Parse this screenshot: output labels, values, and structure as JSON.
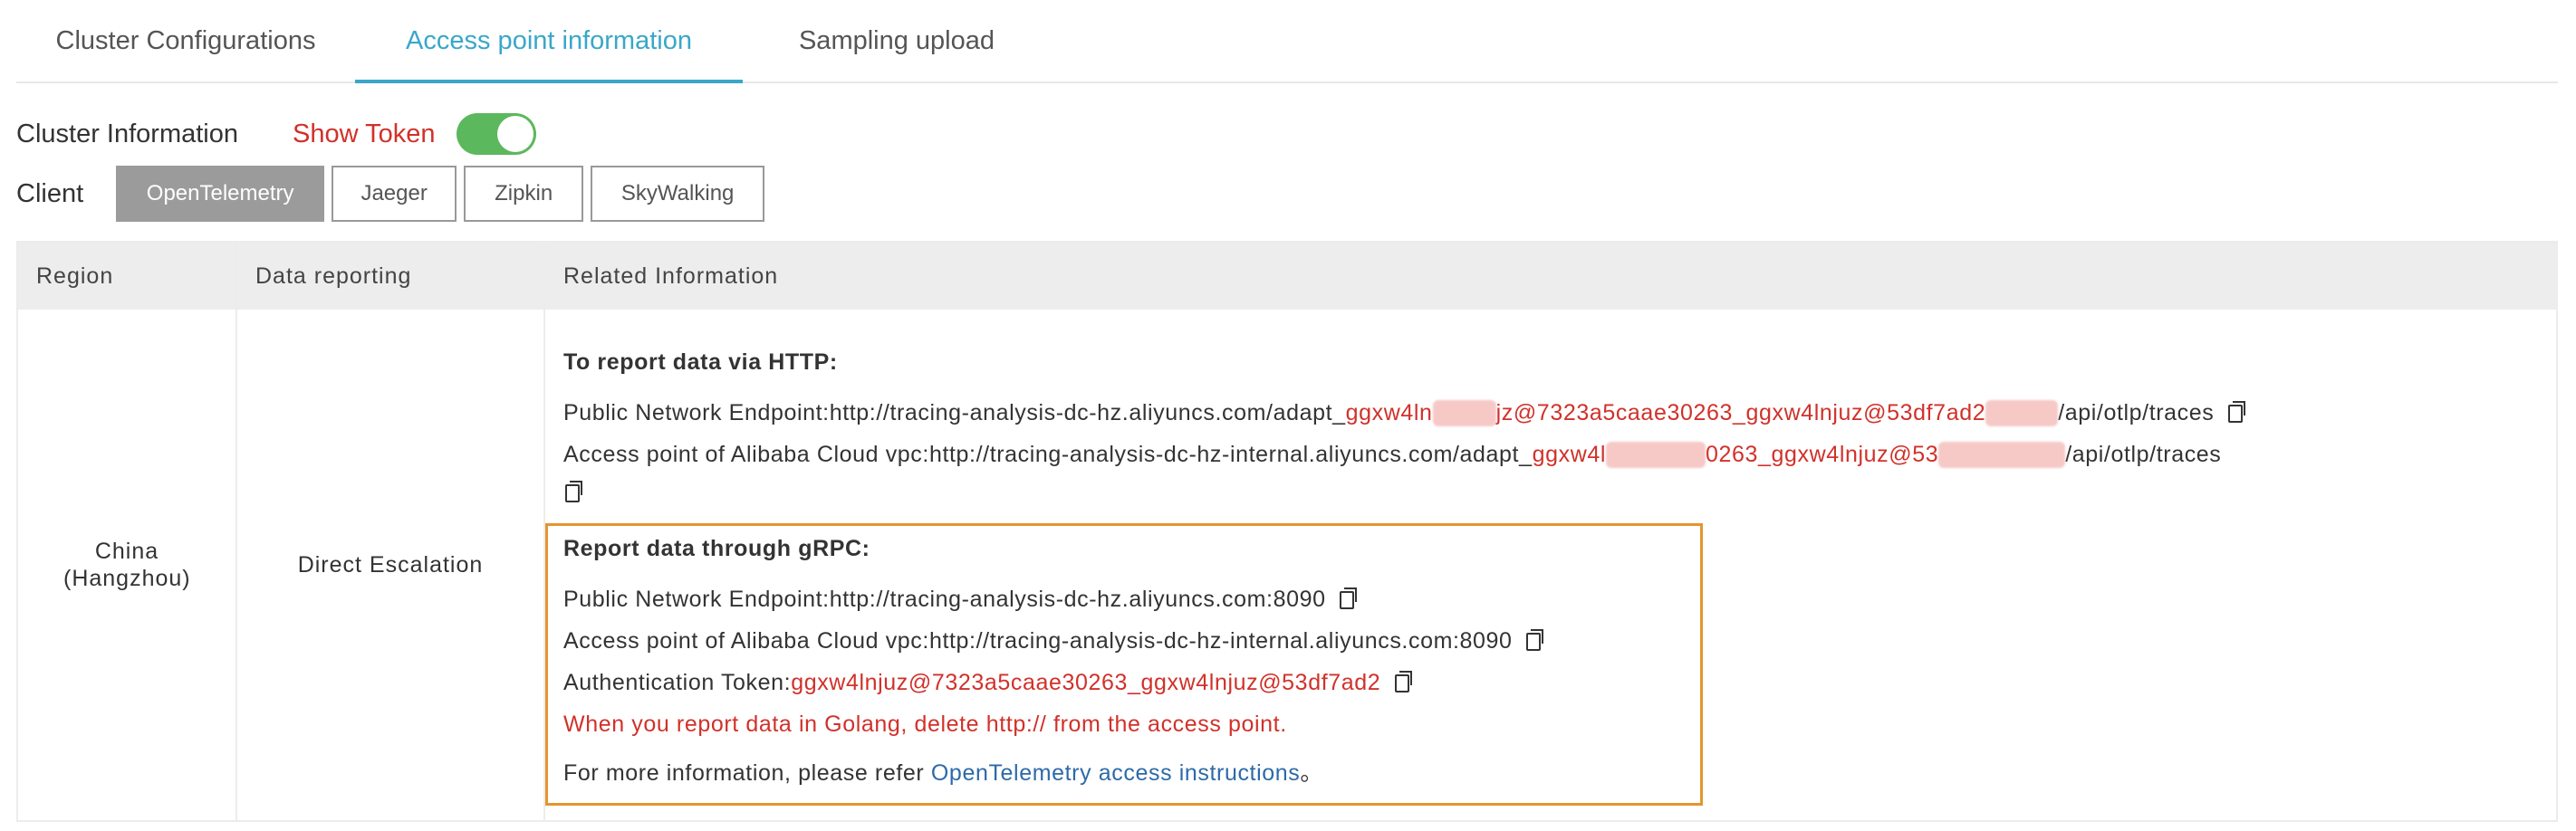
{
  "tabs": {
    "cluster": "Cluster Configurations",
    "access": "Access point information",
    "sampling": "Sampling upload"
  },
  "cluster": {
    "label": "Cluster Information",
    "show_token": "Show Token",
    "toggle_on": true
  },
  "client": {
    "label": "Client",
    "options": [
      "OpenTelemetry",
      "Jaeger",
      "Zipkin",
      "SkyWalking"
    ],
    "selected": "OpenTelemetry"
  },
  "table": {
    "headers": [
      "Region",
      "Data reporting",
      "Related Information"
    ],
    "region": "China (Hangzhou)",
    "data_reporting": "Direct Escalation",
    "http": {
      "title": "To report data via HTTP:",
      "public_prefix": "Public Network Endpoint:http://tracing-analysis-dc-hz.aliyuncs.com/adapt_",
      "public_token_a": "ggxw4ln",
      "public_token_mid": "jz@7323a5caae30263_ggxw4lnjuz@53df7ad2",
      "public_suffix": "/api/otlp/traces",
      "vpc_prefix": "Access point of Alibaba Cloud vpc:http://tracing-analysis-dc-hz-internal.aliyuncs.com/adapt_",
      "vpc_token_a": "ggxw4l",
      "vpc_token_mid": "0263_ggxw4lnjuz@53",
      "vpc_suffix": "/api/otlp/traces"
    },
    "grpc": {
      "title": "Report data through gRPC:",
      "public": "Public Network Endpoint:http://tracing-analysis-dc-hz.aliyuncs.com:8090",
      "vpc": "Access point of Alibaba Cloud vpc:http://tracing-analysis-dc-hz-internal.aliyuncs.com:8090",
      "auth_prefix": "Authentication Token:",
      "auth_token": "ggxw4lnjuz@7323a5caae30263_ggxw4lnjuz@53df7ad2",
      "golang_note": "When you report data in Golang, delete http:// from the access point.",
      "more_prefix": "For more information, please refer ",
      "more_link": "OpenTelemetry access instructions",
      "more_suffix": "。"
    }
  },
  "colors": {
    "accent": "#3aa7c9",
    "danger": "#d1312a",
    "toggle": "#5cb85c",
    "highlight_box": "#e5952e",
    "link": "#2d6aa9"
  }
}
